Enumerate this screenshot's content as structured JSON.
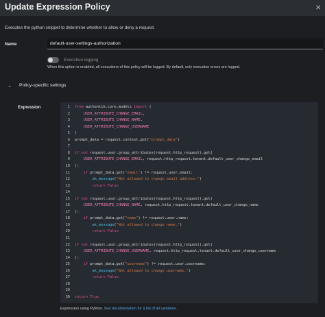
{
  "dialog": {
    "title": "Update Expression Policy",
    "close_glyph": "×"
  },
  "description": "Executes the python snippet to determine whether to allow or deny a request.",
  "name_field": {
    "label": "Name",
    "value": "default-user-settings-authorization"
  },
  "execution_logging": {
    "label": "Execution logging",
    "enabled": false,
    "helper": "When this option is enabled, all executions of this policy will be logged. By default, only execution errors are logged."
  },
  "section": {
    "label": "Policy-specific settings",
    "chevron_glyph": "⌄"
  },
  "expression": {
    "label": "Expression",
    "lines": [
      [
        [
          "kw",
          "from "
        ],
        [
          "def",
          "authentik.core.models "
        ],
        [
          "kw",
          "import "
        ],
        [
          "def",
          "("
        ]
      ],
      [
        [
          "id",
          "    USER_ATTRIBUTE_CHANGE_EMAIL"
        ],
        [
          "def",
          ","
        ]
      ],
      [
        [
          "id",
          "    USER_ATTRIBUTE_CHANGE_NAME"
        ],
        [
          "def",
          ","
        ]
      ],
      [
        [
          "id",
          "    USER_ATTRIBUTE_CHANGE_USERNAME"
        ]
      ],
      [
        [
          "def",
          ")"
        ]
      ],
      [
        [
          "def",
          "prompt_data = request.context.get("
        ],
        [
          "str",
          "\"prompt_data\""
        ],
        [
          "def",
          ")"
        ]
      ],
      [],
      [
        [
          "kw",
          "if not "
        ],
        [
          "def",
          "request.user.group_attributes(request.http_request).get("
        ]
      ],
      [
        [
          "id",
          "    USER_ATTRIBUTE_CHANGE_EMAIL"
        ],
        [
          "def",
          ", request.http_request.tenant.default_user_change_email"
        ]
      ],
      [
        [
          "def",
          "):"
        ]
      ],
      [
        [
          "kw",
          "    if "
        ],
        [
          "def",
          "prompt_data.get("
        ],
        [
          "str",
          "\"email\""
        ],
        [
          "def",
          ") != request.user.email:"
        ]
      ],
      [
        [
          "fn",
          "        ak_message"
        ],
        [
          "def",
          "("
        ],
        [
          "str",
          "\"Not allowed to change email address.\""
        ],
        [
          "def",
          ")"
        ]
      ],
      [
        [
          "kw",
          "        return False"
        ]
      ],
      [],
      [
        [
          "kw",
          "if not "
        ],
        [
          "def",
          "request.user.group_attributes(request.http_request).get("
        ]
      ],
      [
        [
          "id",
          "    USER_ATTRIBUTE_CHANGE_NAME"
        ],
        [
          "def",
          ", request.http_request.tenant.default_user_change_name"
        ]
      ],
      [
        [
          "def",
          "):"
        ]
      ],
      [
        [
          "kw",
          "    if "
        ],
        [
          "def",
          "prompt_data.get("
        ],
        [
          "str",
          "\"name\""
        ],
        [
          "def",
          ") != request.user.name:"
        ]
      ],
      [
        [
          "fn",
          "        ak_message"
        ],
        [
          "def",
          "("
        ],
        [
          "str",
          "\"Not allowed to change name.\""
        ],
        [
          "def",
          ")"
        ]
      ],
      [
        [
          "kw",
          "        return False"
        ]
      ],
      [],
      [
        [
          "kw",
          "if not "
        ],
        [
          "def",
          "request.user.group_attributes(request.http_request).get("
        ]
      ],
      [
        [
          "id",
          "    USER_ATTRIBUTE_CHANGE_USERNAME"
        ],
        [
          "def",
          ", request.http_request.tenant.default_user_change_username"
        ]
      ],
      [
        [
          "def",
          "):"
        ]
      ],
      [
        [
          "kw",
          "    if "
        ],
        [
          "def",
          "prompt_data.get("
        ],
        [
          "str",
          "\"username\""
        ],
        [
          "def",
          ") != request.user.username:"
        ]
      ],
      [
        [
          "fn",
          "        ak_message"
        ],
        [
          "def",
          "("
        ],
        [
          "str",
          "\"Not allowed to change username.\""
        ],
        [
          "def",
          ")"
        ]
      ],
      [
        [
          "kw",
          "        return False"
        ]
      ],
      [],
      [],
      [
        [
          "kw",
          "return True"
        ]
      ]
    ]
  },
  "footer": {
    "prefix": "Expression using Python. ",
    "link": "See documentation for a list of all variables."
  }
}
